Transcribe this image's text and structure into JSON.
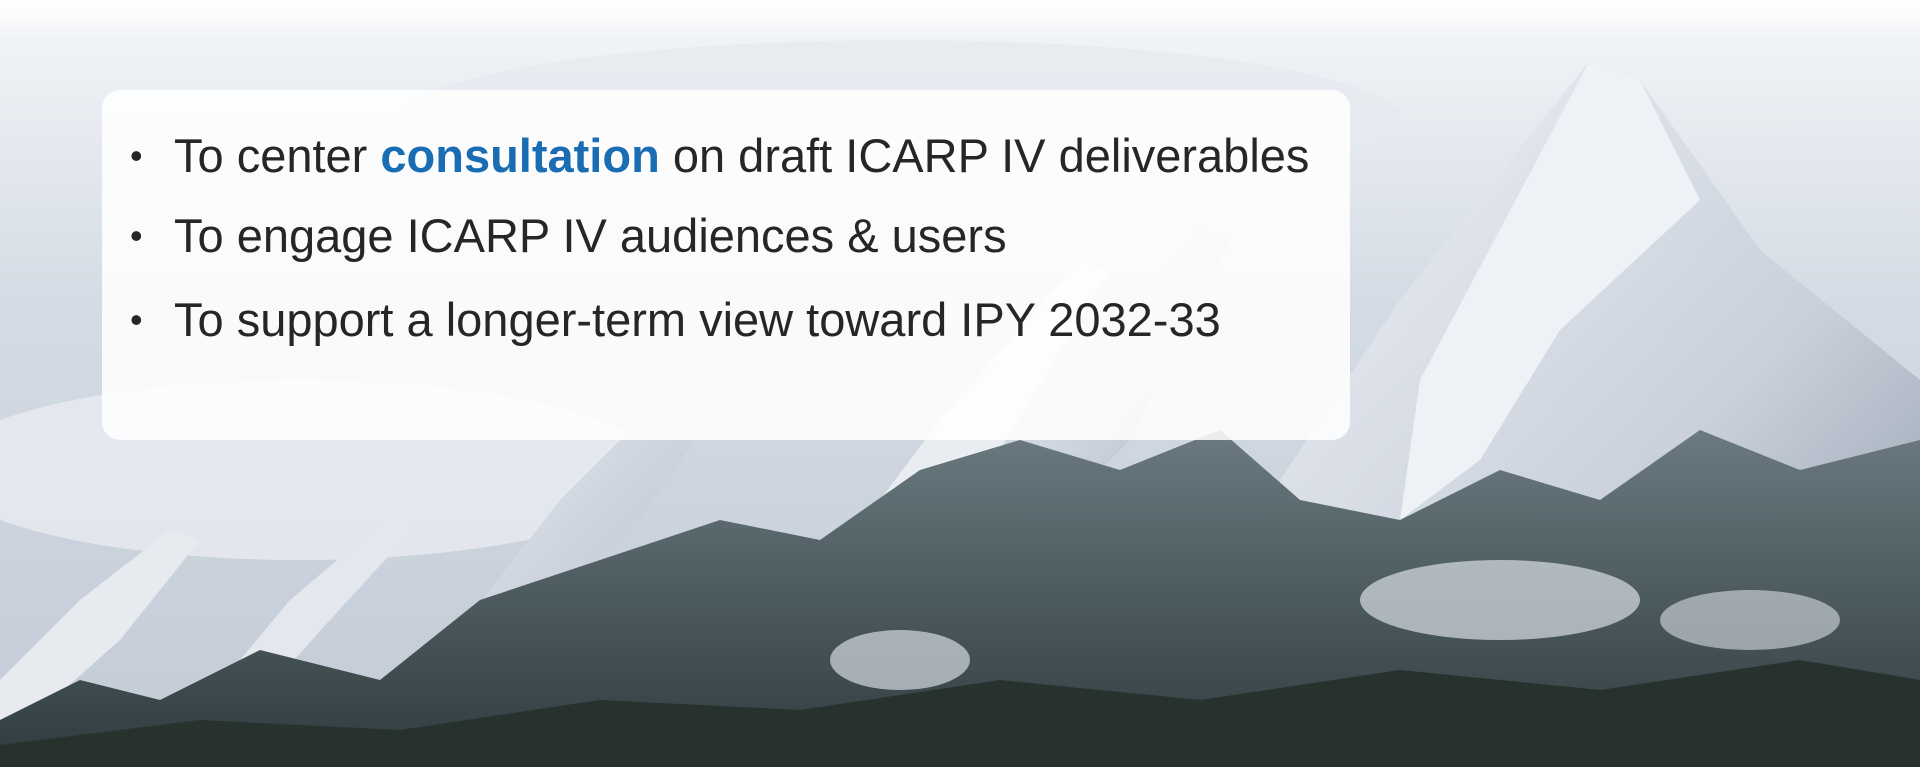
{
  "bullets": [
    {
      "pre": "To center ",
      "highlight": "consultation",
      "post": " on draft ICARP IV deliverables"
    },
    {
      "pre": "To engage ICARP IV audiences & users",
      "highlight": "",
      "post": ""
    },
    {
      "pre": "To support a longer-term view toward IPY 2032-33",
      "highlight": "",
      "post": ""
    }
  ],
  "bullet_symbol": "•",
  "colors": {
    "highlight": "#1a6db3",
    "text": "#262626",
    "panel": "#ffffff",
    "sky": "#cfd6e0",
    "forest": "#3a4a4c"
  },
  "background_image": "snowy-flatirons-mountains"
}
